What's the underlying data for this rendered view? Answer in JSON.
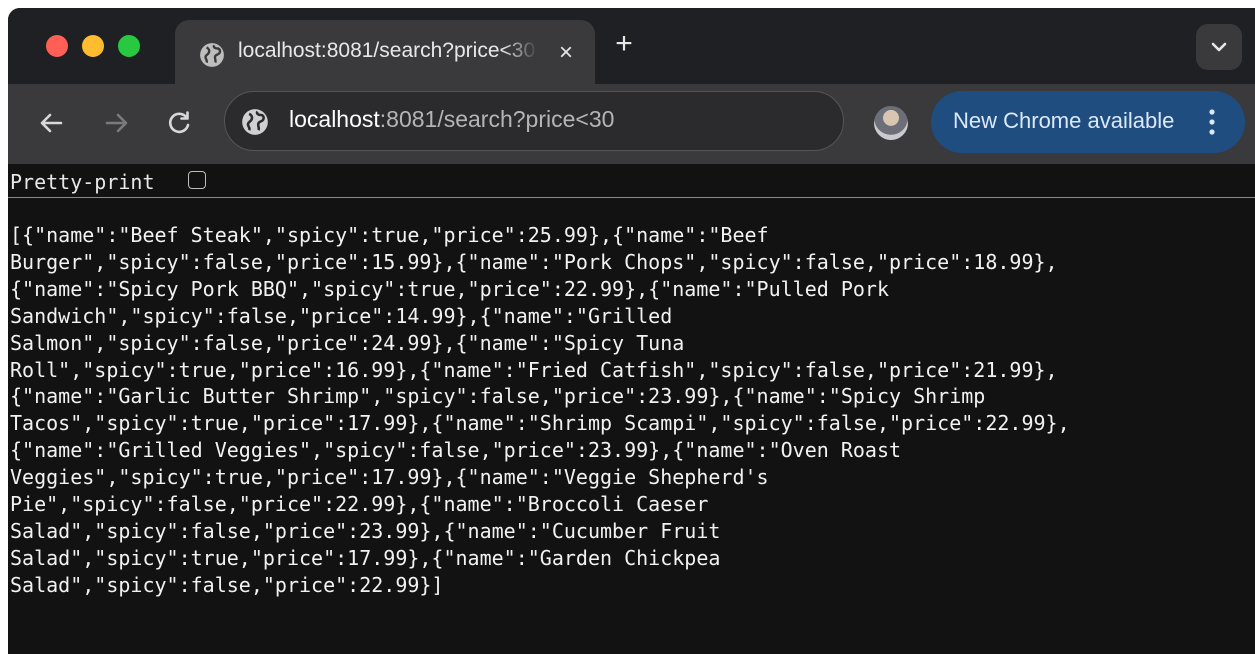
{
  "browser": {
    "tab": {
      "title": "localhost:8081/search?price<30",
      "close_icon": "×",
      "favicon": "globe-icon"
    },
    "new_tab_icon": "+",
    "tab_search_icon": "chevron-down-icon",
    "address": {
      "host": "localhost",
      "rest": ":8081/search?price<30",
      "icon": "site-info-icon"
    },
    "update_button": {
      "label": "New Chrome available",
      "color": "#1f4d80"
    },
    "traffic_lights": {
      "close": "#fe5f57",
      "minimize": "#febc2e",
      "zoom": "#28c840"
    }
  },
  "page": {
    "pretty_print_label": "Pretty-print",
    "pretty_print_checked": false,
    "json_lines": [
      "[{\"name\":\"Beef Steak\",\"spicy\":true,\"price\":25.99},{\"name\":\"Beef",
      "Burger\",\"spicy\":false,\"price\":15.99},{\"name\":\"Pork Chops\",\"spicy\":false,\"price\":18.99},",
      "{\"name\":\"Spicy Pork BBQ\",\"spicy\":true,\"price\":22.99},{\"name\":\"Pulled Pork",
      "Sandwich\",\"spicy\":false,\"price\":14.99},{\"name\":\"Grilled",
      "Salmon\",\"spicy\":false,\"price\":24.99},{\"name\":\"Spicy Tuna",
      "Roll\",\"spicy\":true,\"price\":16.99},{\"name\":\"Fried Catfish\",\"spicy\":false,\"price\":21.99},",
      "{\"name\":\"Garlic Butter Shrimp\",\"spicy\":false,\"price\":23.99},{\"name\":\"Spicy Shrimp",
      "Tacos\",\"spicy\":true,\"price\":17.99},{\"name\":\"Shrimp Scampi\",\"spicy\":false,\"price\":22.99},",
      "{\"name\":\"Grilled Veggies\",\"spicy\":false,\"price\":23.99},{\"name\":\"Oven Roast",
      "Veggies\",\"spicy\":true,\"price\":17.99},{\"name\":\"Veggie Shepherd's",
      "Pie\",\"spicy\":false,\"price\":22.99},{\"name\":\"Broccoli Caeser",
      "Salad\",\"spicy\":false,\"price\":23.99},{\"name\":\"Cucumber Fruit",
      "Salad\",\"spicy\":true,\"price\":17.99},{\"name\":\"Garden Chickpea",
      "Salad\",\"spicy\":false,\"price\":22.99}]"
    ]
  }
}
